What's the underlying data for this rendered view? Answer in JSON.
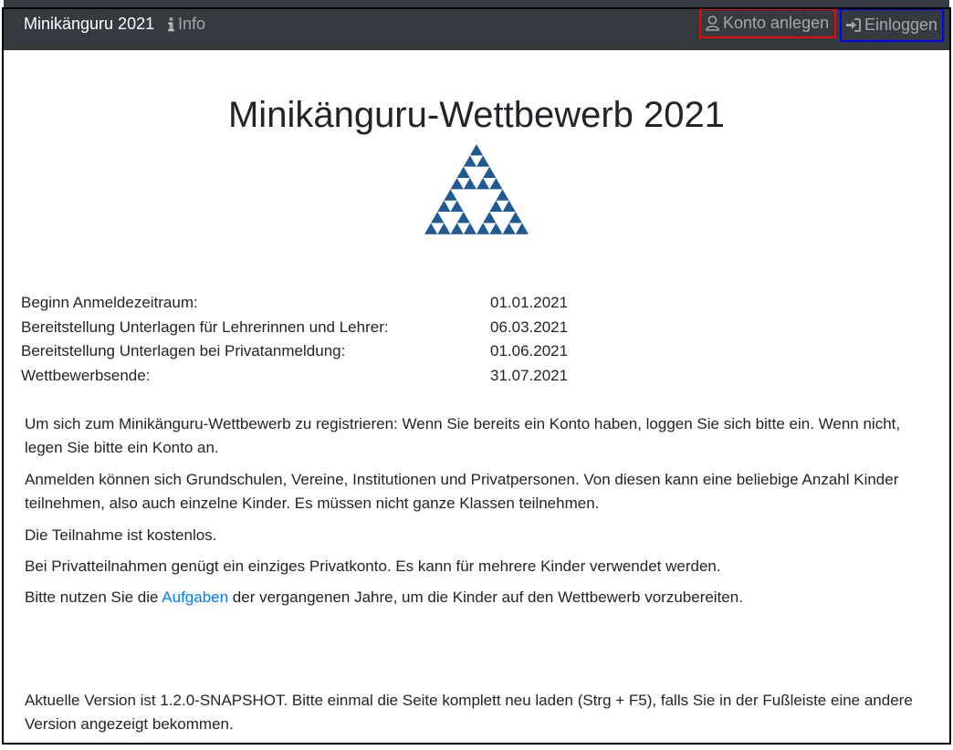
{
  "navbar": {
    "brand": "Minikänguru 2021",
    "info_label": "Info",
    "create_account_label": "Konto anlegen",
    "login_label": "Einloggen"
  },
  "main": {
    "title": "Minikänguru-Wettbewerb 2021",
    "dates": [
      {
        "label": "Beginn Anmeldezeitraum:",
        "value": "01.01.2021"
      },
      {
        "label": "Bereitstellung Unterlagen für Lehrerinnen und Lehrer:",
        "value": "06.03.2021"
      },
      {
        "label": "Bereitstellung Unterlagen bei Privatanmeldung:",
        "value": "01.06.2021"
      },
      {
        "label": "Wettbewerbsende:",
        "value": "31.07.2021"
      }
    ],
    "paragraphs": {
      "register": "Um sich zum Minikänguru-Wettbewerb zu registrieren: Wenn Sie bereits ein Konto haben, loggen Sie sich bitte ein. Wenn nicht, legen Sie bitte ein Konto an.",
      "participants": "Anmelden können sich Grundschulen, Vereine, Institutionen und Privatpersonen. Von diesen kann eine beliebige Anzahl Kinder teilnehmen, also auch einzelne Kinder. Es müssen nicht ganze Klassen teilnehmen.",
      "free": "Die Teilnahme ist kostenlos.",
      "private": "Bei Privatteilnahmen genügt ein einziges Privatkonto. Es kann für mehrere Kinder verwendet werden.",
      "tasks_before": "Bitte nutzen Sie die ",
      "tasks_link": "Aufgaben",
      "tasks_after": " der vergangenen Jahre, um die Kinder auf den Wettbewerb vorzubereiten.",
      "version": "Aktuelle Version ist 1.2.0-SNAPSHOT. Bitte einmal die Seite komplett neu laden (Strg + F5), falls Sie in der Fußleiste eine andere Version angezeigt bekommen."
    }
  },
  "colors": {
    "navbar_bg": "#343a40",
    "logo": "#1f5a94",
    "link": "#007bff"
  }
}
